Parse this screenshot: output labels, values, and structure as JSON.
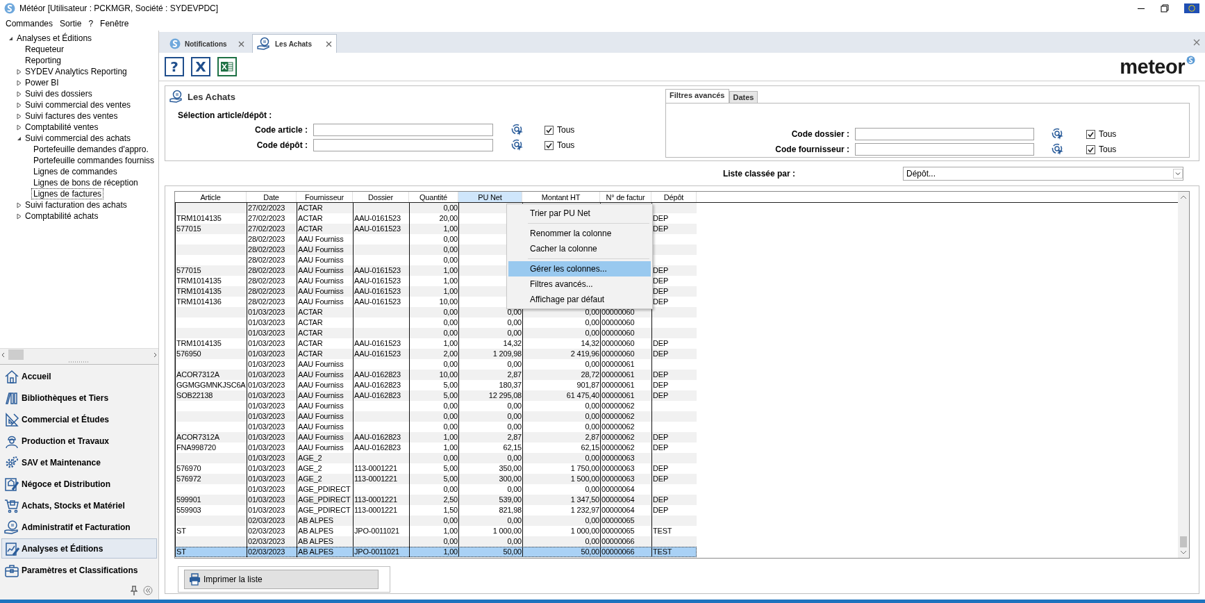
{
  "window": {
    "title": "Météor [Utilisateur : PCKMGR, Société : SYDEVPDC]"
  },
  "menu_bar": [
    "Commandes",
    "Sortie",
    "?",
    "Fenêtre"
  ],
  "tree": [
    {
      "label": "Analyses et Éditions",
      "kind": "group",
      "expanded": true,
      "selected": false,
      "children": [
        {
          "label": "Requeteur",
          "kind": "leaf",
          "selected": false
        },
        {
          "label": "Reporting",
          "kind": "leaf",
          "selected": false
        },
        {
          "label": "SYDEV Analytics Reporting",
          "kind": "group",
          "expanded": false,
          "selected": false
        },
        {
          "label": "Power BI",
          "kind": "group",
          "expanded": false,
          "selected": false
        },
        {
          "label": "Suivi des dossiers",
          "kind": "group",
          "expanded": false,
          "selected": false
        },
        {
          "label": "Suivi commercial des ventes",
          "kind": "group",
          "expanded": false,
          "selected": false
        },
        {
          "label": "Suivi factures des ventes",
          "kind": "group",
          "expanded": false,
          "selected": false
        },
        {
          "label": "Comptabilité ventes",
          "kind": "group",
          "expanded": false,
          "selected": false
        },
        {
          "label": "Suivi commercial des achats",
          "kind": "group",
          "expanded": true,
          "selected": false,
          "children": [
            {
              "label": "Portefeuille demandes d'appro.",
              "kind": "leaf",
              "selected": false
            },
            {
              "label": "Portefeuille commandes fourniss",
              "kind": "leaf",
              "selected": false
            },
            {
              "label": "Lignes de commandes",
              "kind": "leaf",
              "selected": false
            },
            {
              "label": "Lignes de bons de réception",
              "kind": "leaf",
              "selected": false
            },
            {
              "label": "Lignes de factures",
              "kind": "leaf",
              "selected": true
            }
          ]
        },
        {
          "label": "Suivi facturation des achats",
          "kind": "group",
          "expanded": false,
          "selected": false
        },
        {
          "label": "Comptabilité achats",
          "kind": "group",
          "expanded": false,
          "selected": false
        }
      ]
    }
  ],
  "nav": [
    {
      "label": "Accueil",
      "kind": "home",
      "selected": false
    },
    {
      "label": "Bibliothèques et Tiers",
      "kind": "books",
      "selected": false
    },
    {
      "label": "Commercial et Études",
      "kind": "square",
      "selected": false
    },
    {
      "label": "Production et Travaux",
      "kind": "worker",
      "selected": false
    },
    {
      "label": "SAV et Maintenance",
      "kind": "gears",
      "selected": false
    },
    {
      "label": "Négoce et Distribution",
      "kind": "document",
      "selected": false
    },
    {
      "label": "Achats, Stocks et Matériel",
      "kind": "cart",
      "selected": false
    },
    {
      "label": "Administratif et Facturation",
      "kind": "coin",
      "selected": false
    },
    {
      "label": "Analyses et Éditions",
      "kind": "report",
      "selected": true
    },
    {
      "label": "Paramètres et Classifications",
      "kind": "toolbox",
      "selected": false
    }
  ],
  "tabs": [
    {
      "label": "Notifications",
      "kind": "logo",
      "selected": false
    },
    {
      "label": "Les Achats",
      "kind": "coin",
      "selected": true
    }
  ],
  "toolbar": [
    {
      "kind": "help",
      "label": "?"
    },
    {
      "kind": "cancel",
      "label": "X"
    },
    {
      "kind": "excel"
    }
  ],
  "brand": "meteor",
  "panel": {
    "title": "Les Achats",
    "section": "Sélection article/dépôt :",
    "fields": [
      {
        "label": "Code article :",
        "all_label": "Tous",
        "checked": true
      },
      {
        "label": "Code dépôt :",
        "all_label": "Tous",
        "checked": true
      }
    ]
  },
  "advanced": {
    "tabs": [
      {
        "label": "Filtres avancés",
        "selected": true
      },
      {
        "label": "Dates",
        "selected": false
      }
    ],
    "fields": [
      {
        "label": "Code dossier :",
        "all_label": "Tous",
        "checked": true
      },
      {
        "label": "Code fournisseur :",
        "all_label": "Tous",
        "checked": true
      }
    ]
  },
  "sort": {
    "label": "Liste classée par :",
    "value": "Dépôt..."
  },
  "table": {
    "columns": [
      {
        "label": "Article",
        "kind": "text",
        "selected": false
      },
      {
        "label": "Date",
        "kind": "text",
        "selected": false
      },
      {
        "label": "Fournisseur",
        "kind": "text",
        "selected": false
      },
      {
        "label": "Dossier",
        "kind": "text",
        "selected": false
      },
      {
        "label": "Quantité",
        "kind": "number",
        "selected": false
      },
      {
        "label": "PU Net",
        "kind": "number",
        "selected": true
      },
      {
        "label": "Montant HT",
        "kind": "number",
        "selected": false
      },
      {
        "label": "N° de factur",
        "kind": "text",
        "selected": false
      },
      {
        "label": "Dépôt",
        "kind": "text",
        "selected": false
      }
    ],
    "rows": [
      {
        "date": "27/02/2023",
        "fournisseur": "ACTAR",
        "quantite": "0,00",
        "selected": false
      },
      {
        "article": "TRM1014135",
        "date": "27/02/2023",
        "fournisseur": "ACTAR",
        "dossier": "AAU-0161523",
        "quantite": "20,00",
        "depot": "DEP",
        "selected": false
      },
      {
        "article": "577015",
        "date": "27/02/2023",
        "fournisseur": "ACTAR",
        "dossier": "AAU-0161523",
        "quantite": "1,00",
        "depot": "DEP",
        "selected": false
      },
      {
        "date": "28/02/2023",
        "fournisseur": "AAU Fourniss",
        "quantite": "0,00",
        "selected": false
      },
      {
        "date": "28/02/2023",
        "fournisseur": "AAU Fourniss",
        "quantite": "0,00",
        "selected": false
      },
      {
        "date": "28/02/2023",
        "fournisseur": "AAU Fourniss",
        "quantite": "0,00",
        "selected": false
      },
      {
        "article": "577015",
        "date": "28/02/2023",
        "fournisseur": "AAU Fourniss",
        "dossier": "AAU-0161523",
        "quantite": "1,00",
        "depot": "DEP",
        "selected": false
      },
      {
        "article": "TRM1014135",
        "date": "28/02/2023",
        "fournisseur": "AAU Fourniss",
        "dossier": "AAU-0161523",
        "quantite": "1,00",
        "depot": "DEP",
        "selected": false
      },
      {
        "article": "TRM1014135",
        "date": "28/02/2023",
        "fournisseur": "AAU Fourniss",
        "dossier": "AAU-0161523",
        "quantite": "1,00",
        "depot": "DEP",
        "selected": false
      },
      {
        "article": "TRM1014136",
        "date": "28/02/2023",
        "fournisseur": "AAU Fourniss",
        "dossier": "AAU-0161523",
        "quantite": "10,00",
        "depot": "DEP",
        "selected": false
      },
      {
        "date": "01/03/2023",
        "fournisseur": "ACTAR",
        "quantite": "0,00",
        "pu_net": "0,00",
        "montant_ht": "0,00",
        "no_facture": "00000060",
        "selected": false
      },
      {
        "date": "01/03/2023",
        "fournisseur": "ACTAR",
        "quantite": "0,00",
        "pu_net": "0,00",
        "montant_ht": "0,00",
        "no_facture": "00000060",
        "selected": false
      },
      {
        "date": "01/03/2023",
        "fournisseur": "ACTAR",
        "quantite": "0,00",
        "pu_net": "0,00",
        "montant_ht": "0,00",
        "no_facture": "00000060",
        "selected": false
      },
      {
        "article": "TRM1014135",
        "date": "01/03/2023",
        "fournisseur": "ACTAR",
        "dossier": "AAU-0161523",
        "quantite": "1,00",
        "pu_net": "14,32",
        "montant_ht": "14,32",
        "no_facture": "00000060",
        "depot": "DEP",
        "selected": false
      },
      {
        "article": "576950",
        "date": "01/03/2023",
        "fournisseur": "ACTAR",
        "dossier": "AAU-0161523",
        "quantite": "2,00",
        "pu_net": "1 209,98",
        "montant_ht": "2 419,96",
        "no_facture": "00000060",
        "depot": "DEP",
        "selected": false
      },
      {
        "date": "01/03/2023",
        "fournisseur": "AAU Fourniss",
        "quantite": "0,00",
        "pu_net": "0,00",
        "montant_ht": "0,00",
        "no_facture": "00000061",
        "selected": false
      },
      {
        "article": "ACOR7312A",
        "date": "01/03/2023",
        "fournisseur": "AAU Fourniss",
        "dossier": "AAU-0162823",
        "quantite": "10,00",
        "pu_net": "2,87",
        "montant_ht": "28,72",
        "no_facture": "00000061",
        "depot": "DEP",
        "selected": false
      },
      {
        "article": "GGMGGMNKJSC6A",
        "date": "01/03/2023",
        "fournisseur": "AAU Fourniss",
        "dossier": "AAU-0162823",
        "quantite": "5,00",
        "pu_net": "180,37",
        "montant_ht": "901,87",
        "no_facture": "00000061",
        "depot": "DEP",
        "selected": false
      },
      {
        "article": "SOB22138",
        "date": "01/03/2023",
        "fournisseur": "AAU Fourniss",
        "dossier": "AAU-0162823",
        "quantite": "5,00",
        "pu_net": "12 295,08",
        "montant_ht": "61 475,40",
        "no_facture": "00000061",
        "depot": "DEP",
        "selected": false
      },
      {
        "date": "01/03/2023",
        "fournisseur": "AAU Fourniss",
        "quantite": "0,00",
        "pu_net": "0,00",
        "montant_ht": "0,00",
        "no_facture": "00000062",
        "selected": false
      },
      {
        "date": "01/03/2023",
        "fournisseur": "AAU Fourniss",
        "quantite": "0,00",
        "pu_net": "0,00",
        "montant_ht": "0,00",
        "no_facture": "00000062",
        "selected": false
      },
      {
        "date": "01/03/2023",
        "fournisseur": "AAU Fourniss",
        "quantite": "0,00",
        "pu_net": "0,00",
        "montant_ht": "0,00",
        "no_facture": "00000062",
        "selected": false
      },
      {
        "article": "ACOR7312A",
        "date": "01/03/2023",
        "fournisseur": "AAU Fourniss",
        "dossier": "AAU-0162823",
        "quantite": "1,00",
        "pu_net": "2,87",
        "montant_ht": "2,87",
        "no_facture": "00000062",
        "depot": "DEP",
        "selected": false
      },
      {
        "article": "FNA998720",
        "date": "01/03/2023",
        "fournisseur": "AAU Fourniss",
        "dossier": "AAU-0162823",
        "quantite": "1,00",
        "pu_net": "62,15",
        "montant_ht": "62,15",
        "no_facture": "00000062",
        "depot": "DEP",
        "selected": false
      },
      {
        "date": "01/03/2023",
        "fournisseur": "AGE_2",
        "quantite": "0,00",
        "pu_net": "0,00",
        "montant_ht": "0,00",
        "no_facture": "00000063",
        "selected": false
      },
      {
        "article": "576970",
        "date": "01/03/2023",
        "fournisseur": "AGE_2",
        "dossier": "113-0001221",
        "quantite": "5,00",
        "pu_net": "350,00",
        "montant_ht": "1 750,00",
        "no_facture": "00000063",
        "depot": "DEP",
        "selected": false
      },
      {
        "article": "576972",
        "date": "01/03/2023",
        "fournisseur": "AGE_2",
        "dossier": "113-0001221",
        "quantite": "5,00",
        "pu_net": "300,00",
        "montant_ht": "1 500,00",
        "no_facture": "00000063",
        "depot": "DEP",
        "selected": false
      },
      {
        "date": "01/03/2023",
        "fournisseur": "AGE_PDIRECT",
        "quantite": "0,00",
        "pu_net": "0,00",
        "montant_ht": "0,00",
        "no_facture": "00000064",
        "selected": false
      },
      {
        "article": "599901",
        "date": "01/03/2023",
        "fournisseur": "AGE_PDIRECT",
        "dossier": "113-0001221",
        "quantite": "2,50",
        "pu_net": "539,00",
        "montant_ht": "1 347,50",
        "no_facture": "00000064",
        "depot": "DEP",
        "selected": false
      },
      {
        "article": "559903",
        "date": "01/03/2023",
        "fournisseur": "AGE_PDIRECT",
        "dossier": "113-0001221",
        "quantite": "1,50",
        "pu_net": "821,98",
        "montant_ht": "1 232,97",
        "no_facture": "00000064",
        "depot": "DEP",
        "selected": false
      },
      {
        "date": "02/03/2023",
        "fournisseur": "AB ALPES",
        "quantite": "0,00",
        "pu_net": "0,00",
        "montant_ht": "0,00",
        "no_facture": "00000065",
        "selected": false
      },
      {
        "article": "ST",
        "date": "02/03/2023",
        "fournisseur": "AB ALPES",
        "dossier": "JPO-0011021",
        "quantite": "1,00",
        "pu_net": "1 000,00",
        "montant_ht": "1 000,00",
        "no_facture": "00000065",
        "depot": "TEST",
        "selected": false
      },
      {
        "date": "02/03/2023",
        "fournisseur": "AB ALPES",
        "quantite": "0,00",
        "pu_net": "0,00",
        "montant_ht": "0,00",
        "no_facture": "00000066",
        "selected": false
      },
      {
        "article": "ST",
        "date": "02/03/2023",
        "fournisseur": "AB ALPES",
        "dossier": "JPO-0011021",
        "quantite": "1,00",
        "pu_net": "50,00",
        "montant_ht": "50,00",
        "no_facture": "00000066",
        "depot": "TEST",
        "selected": true
      }
    ]
  },
  "context_menu": {
    "items": [
      {
        "kind": "item",
        "label": "Trier par PU Net",
        "selected": false
      },
      {
        "kind": "separator"
      },
      {
        "kind": "item",
        "label": "Renommer la colonne",
        "selected": false
      },
      {
        "kind": "item",
        "label": "Cacher la colonne",
        "selected": false
      },
      {
        "kind": "separator"
      },
      {
        "kind": "item",
        "label": "Gérer les colonnes...",
        "selected": true
      },
      {
        "kind": "item",
        "label": "Filtres avancés...",
        "selected": false
      },
      {
        "kind": "item",
        "label": "Affichage par défaut",
        "selected": false
      }
    ]
  },
  "print_button": "Imprimer la liste"
}
